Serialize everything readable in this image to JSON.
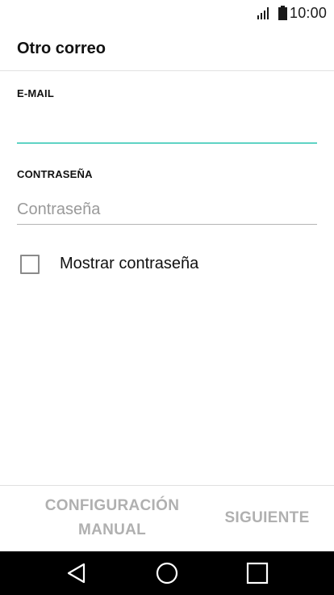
{
  "status_bar": {
    "time": "10:00",
    "signal_icon": "signal-icon",
    "battery_icon": "battery-icon"
  },
  "header": {
    "title": "Otro correo"
  },
  "form": {
    "email": {
      "label": "E-MAIL",
      "value": "",
      "placeholder": ""
    },
    "password": {
      "label": "CONTRASEÑA",
      "value": "",
      "placeholder": "Contraseña"
    },
    "show_password": {
      "label": "Mostrar contraseña",
      "checked": false
    }
  },
  "actions": {
    "manual_line1": "CONFIGURACIÓN",
    "manual_line2": "MANUAL",
    "next": "SIGUIENTE"
  },
  "nav_bar": {
    "back_icon": "back-triangle-icon",
    "home_icon": "home-circle-icon",
    "recents_icon": "recents-square-icon"
  },
  "colors": {
    "accent": "#5fd3c4",
    "disabled_text": "#b0b0b0",
    "nav_background": "#000000"
  }
}
